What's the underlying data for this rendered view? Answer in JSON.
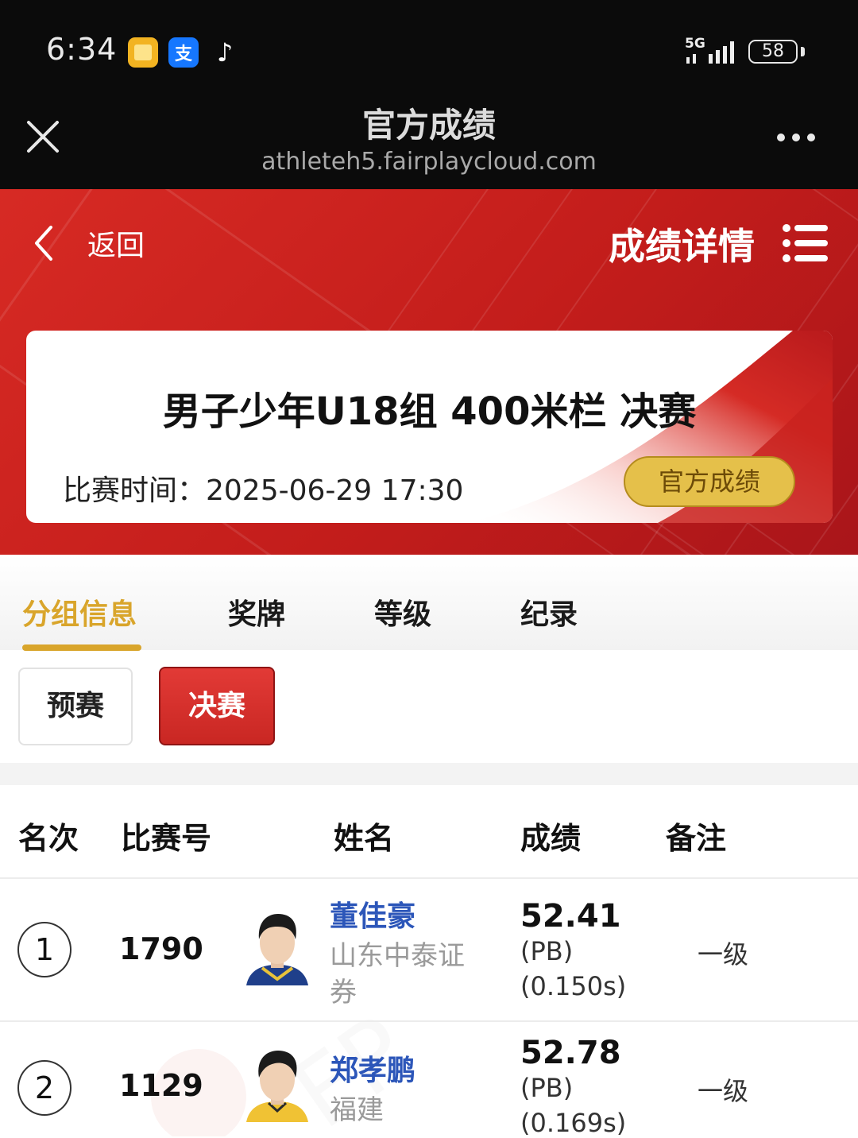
{
  "status_bar": {
    "time": "6:34",
    "network": "5G",
    "battery": "58",
    "icons": [
      "notes-app-icon",
      "alipay-icon",
      "tiktok-icon",
      "signal-icon",
      "battery-icon"
    ]
  },
  "title_bar": {
    "title": "官方成绩",
    "url": "athleteh5.fairplaycloud.com"
  },
  "header": {
    "back_label": "返回",
    "title": "成绩详情"
  },
  "event": {
    "name": "男子少年U18组 400米栏 决赛",
    "time": "比赛时间：2025-06-29  17:30",
    "official_button": "官方成绩"
  },
  "tabs": [
    {
      "label": "分组信息",
      "active": true
    },
    {
      "label": "奖牌",
      "active": false
    },
    {
      "label": "等级",
      "active": false
    },
    {
      "label": "纪录",
      "active": false
    }
  ],
  "rounds": [
    {
      "label": "预赛",
      "active": false
    },
    {
      "label": "决赛",
      "active": true
    }
  ],
  "table": {
    "headers": [
      "名次",
      "比赛号",
      "姓名",
      "成绩",
      "备注"
    ],
    "rows": [
      {
        "rank": "1",
        "bib": "1790",
        "name": "董佳豪",
        "team": "山东中泰证券",
        "result": "52.41",
        "pb": "(PB)",
        "reaction": "(0.150s)",
        "note": "一级"
      },
      {
        "rank": "2",
        "bib": "1129",
        "name": "郑孝鹏",
        "team": "福建",
        "result": "52.78",
        "pb": "(PB)",
        "reaction": "(0.169s)",
        "note": "一级"
      }
    ]
  },
  "colors": {
    "accent_red": "#c92723",
    "gold": "#d9a52b",
    "link_blue": "#2c56b9"
  }
}
